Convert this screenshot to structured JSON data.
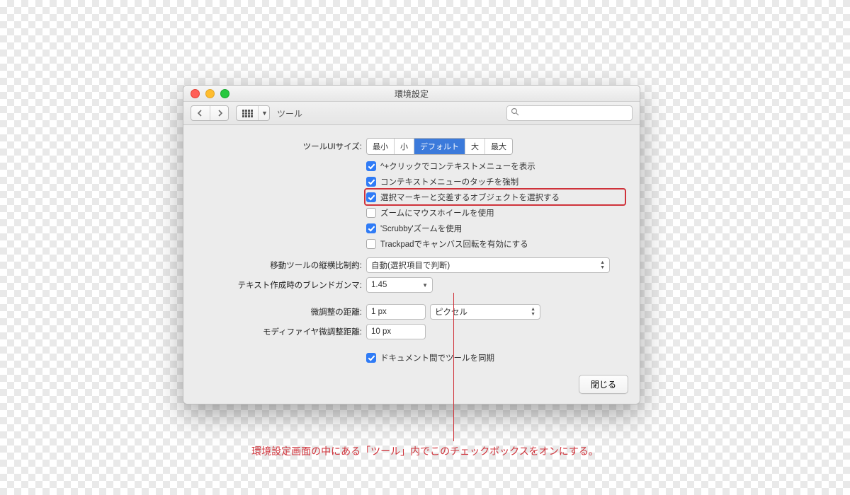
{
  "window": {
    "title": "環境設定"
  },
  "toolbar": {
    "breadcrumb": "ツール"
  },
  "search": {
    "placeholder": ""
  },
  "uiSize": {
    "label": "ツールUIサイズ:",
    "options": [
      "最小",
      "小",
      "デフォルト",
      "大",
      "最大"
    ],
    "selected": "デフォルト"
  },
  "checks": [
    {
      "label": "^+クリックでコンテキストメニューを表示",
      "checked": true,
      "highlight": false
    },
    {
      "label": "コンテキストメニューのタッチを強制",
      "checked": true,
      "highlight": false
    },
    {
      "label": "選択マーキーと交差するオブジェクトを選択する",
      "checked": true,
      "highlight": true
    },
    {
      "label": "ズームにマウスホイールを使用",
      "checked": false,
      "highlight": false
    },
    {
      "label": "'Scrubby'ズームを使用",
      "checked": true,
      "highlight": false
    },
    {
      "label": "Trackpadでキャンバス回転を有効にする",
      "checked": false,
      "highlight": false
    }
  ],
  "aspect": {
    "label": "移動ツールの縦横比制約:",
    "value": "自動(選択項目で判断)"
  },
  "gamma": {
    "label": "テキスト作成時のブレンドガンマ:",
    "value": "1.45"
  },
  "nudge": {
    "label": "微調整の距離:",
    "value": "1 px",
    "unit": "ピクセル"
  },
  "modNudge": {
    "label": "モディファイヤ微調整距離:",
    "value": "10 px"
  },
  "sync": {
    "label": "ドキュメント間でツールを同期",
    "checked": true
  },
  "footer": {
    "close": "閉じる"
  },
  "annotation": "環境設定画面の中にある「ツール」内でこのチェックボックスをオンにする。"
}
